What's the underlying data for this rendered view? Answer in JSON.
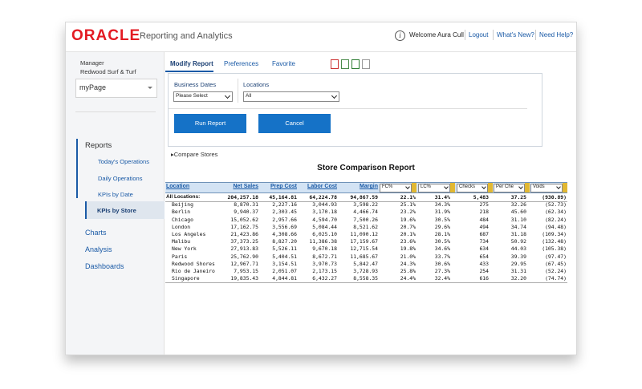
{
  "header": {
    "brand": "ORACLE",
    "app_title": "Reporting and Analytics",
    "welcome": "Welcome Aura Cull",
    "logout": "Logout",
    "whats_new": "What's New?",
    "need_help": "Need Help?",
    "info_glyph": "i"
  },
  "sidebar": {
    "role": "Manager",
    "location": "Redwood Surf & Turf",
    "mypage": "myPage",
    "sections": {
      "reports": "Reports",
      "charts": "Charts",
      "analysis": "Analysis",
      "dashboards": "Dashboards"
    },
    "report_items": [
      "Today's Operations",
      "Daily Operations",
      "KPIs by Date",
      "KPIs by Store"
    ],
    "active_item": "KPIs by Store"
  },
  "tabs": [
    "Modify Report",
    "Preferences",
    "Favorite"
  ],
  "export_icons": [
    "pdf-icon",
    "print-icon",
    "excel-icon",
    "document-icon"
  ],
  "filters": {
    "business_dates_label": "Business Dates",
    "business_dates_value": "Please Select",
    "locations_label": "Locations",
    "locations_value": "All",
    "run_label": "Run Report",
    "cancel_label": "Cancel"
  },
  "compare_label": "Compare Stores",
  "report": {
    "title": "Store Comparison Report",
    "columns": [
      "Location",
      "Net Sales",
      "Prep Cost",
      "Labor Cost",
      "Margin"
    ],
    "filter_columns": [
      "FC%",
      "LC%",
      "Checks",
      "Per Che",
      "Voids"
    ],
    "total": {
      "name": "All Locations:",
      "values": [
        "204,257.18",
        "45,164.81",
        "64,224.78",
        "94,867.59",
        "22.1%",
        "31.4%",
        "5,483",
        "37.25",
        "(930.89)"
      ]
    },
    "rows": [
      {
        "name": "Beijing",
        "values": [
          "8,870.31",
          "2,227.16",
          "3,044.93",
          "3,598.22",
          "25.1%",
          "34.3%",
          "275",
          "32.26",
          "(52.73)"
        ]
      },
      {
        "name": "Berlin",
        "values": [
          "9,940.37",
          "2,303.45",
          "3,170.18",
          "4,466.74",
          "23.2%",
          "31.9%",
          "218",
          "45.60",
          "(62.34)"
        ]
      },
      {
        "name": "Chicago",
        "values": [
          "15,052.62",
          "2,957.66",
          "4,594.70",
          "7,500.26",
          "19.6%",
          "30.5%",
          "484",
          "31.10",
          "(82.24)"
        ]
      },
      {
        "name": "London",
        "values": [
          "17,162.75",
          "3,556.69",
          "5,084.44",
          "8,521.62",
          "20.7%",
          "29.6%",
          "494",
          "34.74",
          "(94.48)"
        ]
      },
      {
        "name": "Los Angeles",
        "values": [
          "21,423.86",
          "4,308.66",
          "6,025.10",
          "11,090.12",
          "20.1%",
          "28.1%",
          "687",
          "31.18",
          "(109.34)"
        ]
      },
      {
        "name": "Malibu",
        "values": [
          "37,373.25",
          "8,827.20",
          "11,386.38",
          "17,159.67",
          "23.6%",
          "30.5%",
          "734",
          "50.92",
          "(132.48)"
        ]
      },
      {
        "name": "New York",
        "values": [
          "27,913.83",
          "5,526.11",
          "9,670.18",
          "12,715.54",
          "19.8%",
          "34.6%",
          "634",
          "44.03",
          "(105.38)"
        ]
      },
      {
        "name": "Paris",
        "values": [
          "25,762.90",
          "5,404.51",
          "8,672.71",
          "11,685.67",
          "21.0%",
          "33.7%",
          "654",
          "39.39",
          "(97.47)"
        ]
      },
      {
        "name": "Redwood Shores",
        "values": [
          "12,967.71",
          "3,154.51",
          "3,970.73",
          "5,842.47",
          "24.3%",
          "30.6%",
          "433",
          "29.95",
          "(67.45)"
        ]
      },
      {
        "name": "Rio de Janeiro",
        "values": [
          "7,953.15",
          "2,051.07",
          "2,173.15",
          "3,728.93",
          "25.8%",
          "27.3%",
          "254",
          "31.31",
          "(52.24)"
        ]
      },
      {
        "name": "Singapore",
        "values": [
          "19,835.43",
          "4,844.81",
          "6,432.27",
          "8,558.35",
          "24.4%",
          "32.4%",
          "616",
          "32.20",
          "(74.74)"
        ]
      }
    ]
  },
  "colors": {
    "brand_red": "#e31b23",
    "link_blue": "#1a5aa6",
    "button_blue": "#1572c7",
    "table_header": "#d3e3f4",
    "filter_handle": "#e2b832"
  }
}
